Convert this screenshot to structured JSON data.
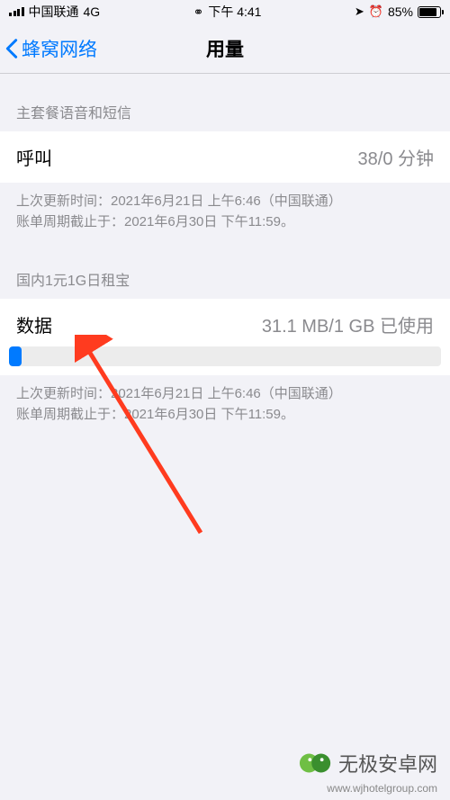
{
  "status_bar": {
    "carrier": "中国联通",
    "network": "4G",
    "time": "下午 4:41",
    "battery_percent": "85%"
  },
  "nav": {
    "back_label": "蜂窝网络",
    "title": "用量"
  },
  "section1": {
    "header": "主套餐语音和短信",
    "call_label": "呼叫",
    "call_value": "38/0 分钟",
    "footer_line1": "上次更新时间：2021年6月21日 上午6:46（中国联通）",
    "footer_line2": "账单周期截止于：2021年6月30日 下午11:59。"
  },
  "section2": {
    "header": "国内1元1G日租宝",
    "data_label": "数据",
    "data_value": "31.1 MB/1 GB 已使用",
    "progress_percent": 3,
    "footer_line1": "上次更新时间：2021年6月21日 上午6:46（中国联通）",
    "footer_line2": "账单周期截止于：2021年6月30日 下午11:59。"
  },
  "watermark": {
    "text": "无极安卓网",
    "url": "www.wjhotelgroup.com"
  }
}
